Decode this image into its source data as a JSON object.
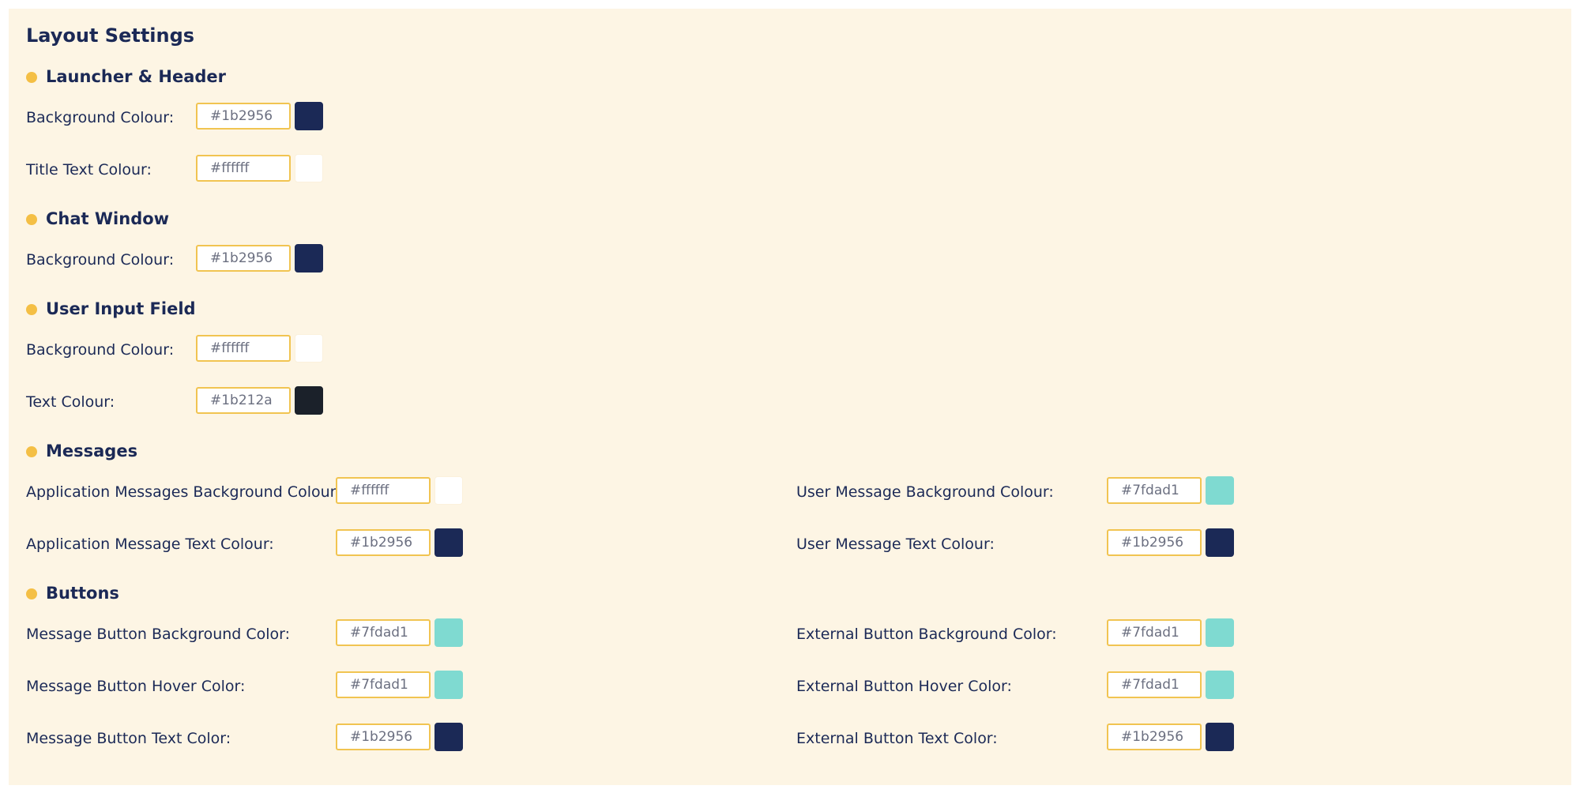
{
  "page": {
    "title": "Layout Settings"
  },
  "sections": {
    "launcher": {
      "title": "Launcher & Header",
      "fields": [
        {
          "label": "Background Colour:",
          "value": "#1b2956",
          "swatch": "#1b2956"
        },
        {
          "label": "Title Text Colour:",
          "value": "#ffffff",
          "swatch": "#ffffff"
        }
      ]
    },
    "chat": {
      "title": "Chat Window",
      "fields": [
        {
          "label": "Background Colour:",
          "value": "#1b2956",
          "swatch": "#1b2956"
        }
      ]
    },
    "input": {
      "title": "User Input Field",
      "fields": [
        {
          "label": "Background Colour:",
          "value": "#ffffff",
          "swatch": "#ffffff"
        },
        {
          "label": "Text Colour:",
          "value": "#1b212a",
          "swatch": "#1b212a"
        }
      ]
    },
    "messages": {
      "title": "Messages",
      "fields": [
        {
          "label": "Application Messages Background Colour:",
          "value": "#ffffff",
          "swatch": "#ffffff"
        },
        {
          "label": "Application Message Text Colour:",
          "value": "#1b2956",
          "swatch": "#1b2956"
        },
        {
          "label": "User Message Background Colour:",
          "value": "#7fdad1",
          "swatch": "#7fdad1"
        },
        {
          "label": "User Message Text Colour:",
          "value": "#1b2956",
          "swatch": "#1b2956"
        }
      ]
    },
    "buttons": {
      "title": "Buttons",
      "fields": [
        {
          "label": "Message Button Background Color:",
          "value": "#7fdad1",
          "swatch": "#7fdad1"
        },
        {
          "label": "Message Button Hover Color:",
          "value": "#7fdad1",
          "swatch": "#7fdad1"
        },
        {
          "label": "Message Button Text Color:",
          "value": "#1b2956",
          "swatch": "#1b2956"
        },
        {
          "label": "External Button Background Color:",
          "value": "#7fdad1",
          "swatch": "#7fdad1"
        },
        {
          "label": "External Button Hover Color:",
          "value": "#7fdad1",
          "swatch": "#7fdad1"
        },
        {
          "label": "External Button Text Color:",
          "value": "#1b2956",
          "swatch": "#1b2956"
        }
      ]
    }
  },
  "colors": {
    "panel_background": "#fdf5e4",
    "heading_text": "#1b2956",
    "bullet": "#f4bf45",
    "input_border": "#f1c451"
  }
}
